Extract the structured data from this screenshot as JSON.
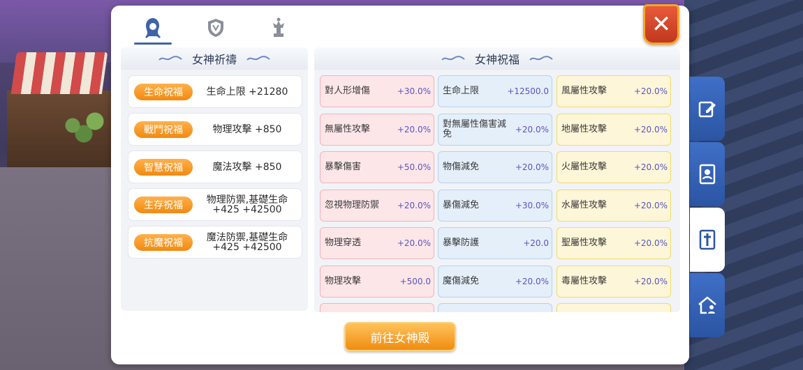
{
  "close_label": "✕",
  "left": {
    "title": "女神祈禱",
    "items": [
      {
        "badge": "生命祝福",
        "value": "生命上限 +21280"
      },
      {
        "badge": "戰鬥祝福",
        "value": "物理攻擊 +850"
      },
      {
        "badge": "智慧祝福",
        "value": "魔法攻擊 +850"
      },
      {
        "badge": "生存祝福",
        "value": "物理防禦,基礎生命 +425 +42500"
      },
      {
        "badge": "抗魔祝福",
        "value": "魔法防禦,基礎生命 +425 +42500"
      }
    ]
  },
  "right": {
    "title": "女神祝福",
    "col1": [
      {
        "name": "對人形增傷",
        "value": "+30.0%"
      },
      {
        "name": "無屬性攻擊",
        "value": "+20.0%"
      },
      {
        "name": "暴擊傷害",
        "value": "+50.0%"
      },
      {
        "name": "忽視物理防禦",
        "value": "+20.0%"
      },
      {
        "name": "物理穿透",
        "value": "+20.0%"
      },
      {
        "name": "物理攻擊",
        "value": "+500.0"
      }
    ],
    "col2": [
      {
        "name": "生命上限",
        "value": "+12500.0"
      },
      {
        "name": "對無屬性傷害減免",
        "value": "+20.0%"
      },
      {
        "name": "物傷減免",
        "value": "+20.0%"
      },
      {
        "name": "暴傷減免",
        "value": "+30.0%"
      },
      {
        "name": "暴擊防護",
        "value": "+20.0"
      },
      {
        "name": "魔傷減免",
        "value": "+20.0%"
      }
    ],
    "col3": [
      {
        "name": "風屬性攻擊",
        "value": "+20.0%"
      },
      {
        "name": "地屬性攻擊",
        "value": "+20.0%"
      },
      {
        "name": "火屬性攻擊",
        "value": "+20.0%"
      },
      {
        "name": "水屬性攻擊",
        "value": "+20.0%"
      },
      {
        "name": "聖屬性攻擊",
        "value": "+20.0%"
      },
      {
        "name": "毒屬性攻擊",
        "value": "+20.0%"
      }
    ]
  },
  "go_button": "前往女神殿",
  "colors": {
    "accent": "#f18a10",
    "nav": "#2b55a3",
    "close": "#c0381e"
  }
}
